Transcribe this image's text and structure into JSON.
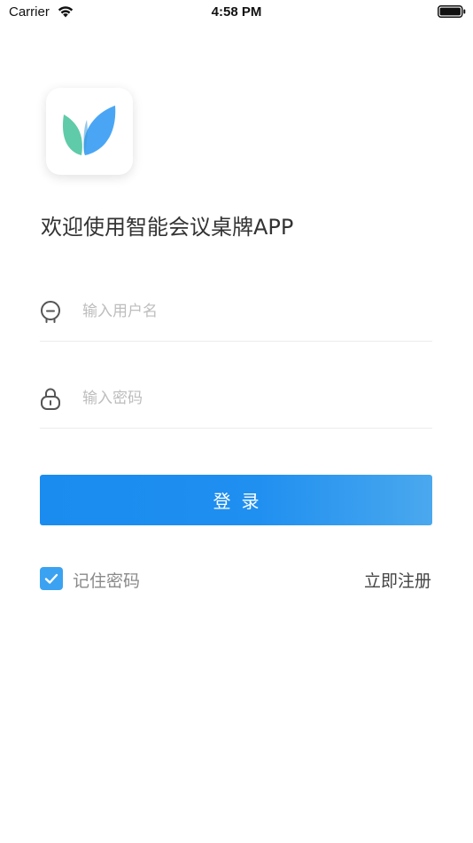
{
  "status_bar": {
    "carrier": "Carrier",
    "time": "4:58 PM"
  },
  "icons": {
    "wifi": "wifi-icon",
    "battery": "battery-icon",
    "logo": "leaf-logo-icon",
    "user": "user-face-icon",
    "lock": "lock-icon",
    "check": "check-icon"
  },
  "colors": {
    "accent": "#1a8cf0",
    "leaf_green": "#5fcba8",
    "leaf_blue": "#4aa6f5"
  },
  "welcome": {
    "title": "欢迎使用智能会议桌牌APP"
  },
  "form": {
    "username_placeholder": "输入用户名",
    "username_value": "",
    "password_placeholder": "输入密码",
    "password_value": "",
    "login_label": "登录",
    "remember_label": "记住密码",
    "remember_checked": true,
    "register_label": "立即注册"
  }
}
